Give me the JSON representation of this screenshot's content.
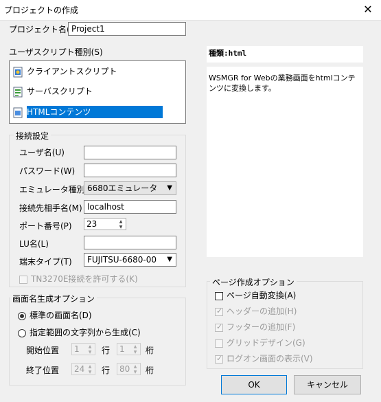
{
  "window": {
    "title": "プロジェクトの作成",
    "close": "✕"
  },
  "project": {
    "label": "プロジェクト名(N)",
    "value": "Project1"
  },
  "script_type": {
    "label": "ユーザスクリプト種別(S)",
    "items": [
      {
        "label": "クライアントスクリプト",
        "icon": "client-script-icon",
        "selected": false
      },
      {
        "label": "サーバスクリプト",
        "icon": "server-script-icon",
        "selected": false
      },
      {
        "label": "HTMLコンテンツ",
        "icon": "html-content-icon",
        "selected": true
      }
    ]
  },
  "info": {
    "kind": "種類:html",
    "description": "WSMGR for Webの業務画面をhtmlコンテンツに変換します。"
  },
  "connection": {
    "legend": "接続設定",
    "user_label": "ユーザ名(U)",
    "user_value": "",
    "password_label": "パスワード(W)",
    "password_value": "",
    "emulator_label": "エミュレータ種別(E)",
    "emulator_value": "6680エミュレータ",
    "host_label": "接続先相手名(M)",
    "host_value": "localhost",
    "port_label": "ポート番号(P)",
    "port_value": "23",
    "lu_label": "LU名(L)",
    "lu_value": "",
    "terminal_label": "端末タイプ(T)",
    "terminal_value": "FUJITSU-6680-00",
    "tn3270e_label": "TN3270E接続を許可する(K)"
  },
  "screen_name": {
    "legend": "画面名生成オプション",
    "standard_label": "標準の画面名(D)",
    "range_label": "指定範囲の文字列から生成(C)",
    "start_label": "開始位置",
    "start_row": "1",
    "start_col": "1",
    "end_label": "終了位置",
    "end_row": "24",
    "end_col": "80",
    "row_unit": "行",
    "col_unit": "桁"
  },
  "page_options": {
    "legend": "ページ作成オプション",
    "auto_convert": "ページ自動変換(A)",
    "add_header": "ヘッダーの追加(H)",
    "add_footer": "フッターの追加(F)",
    "grid_design": "グリッドデザイン(G)",
    "show_logon": "ログオン画面の表示(V)"
  },
  "buttons": {
    "ok": "OK",
    "cancel": "キャンセル"
  },
  "colors": {
    "selection": "#0078d7",
    "dialog_bg": "#f0f0f0",
    "disabled_text": "#9a9a9a"
  }
}
